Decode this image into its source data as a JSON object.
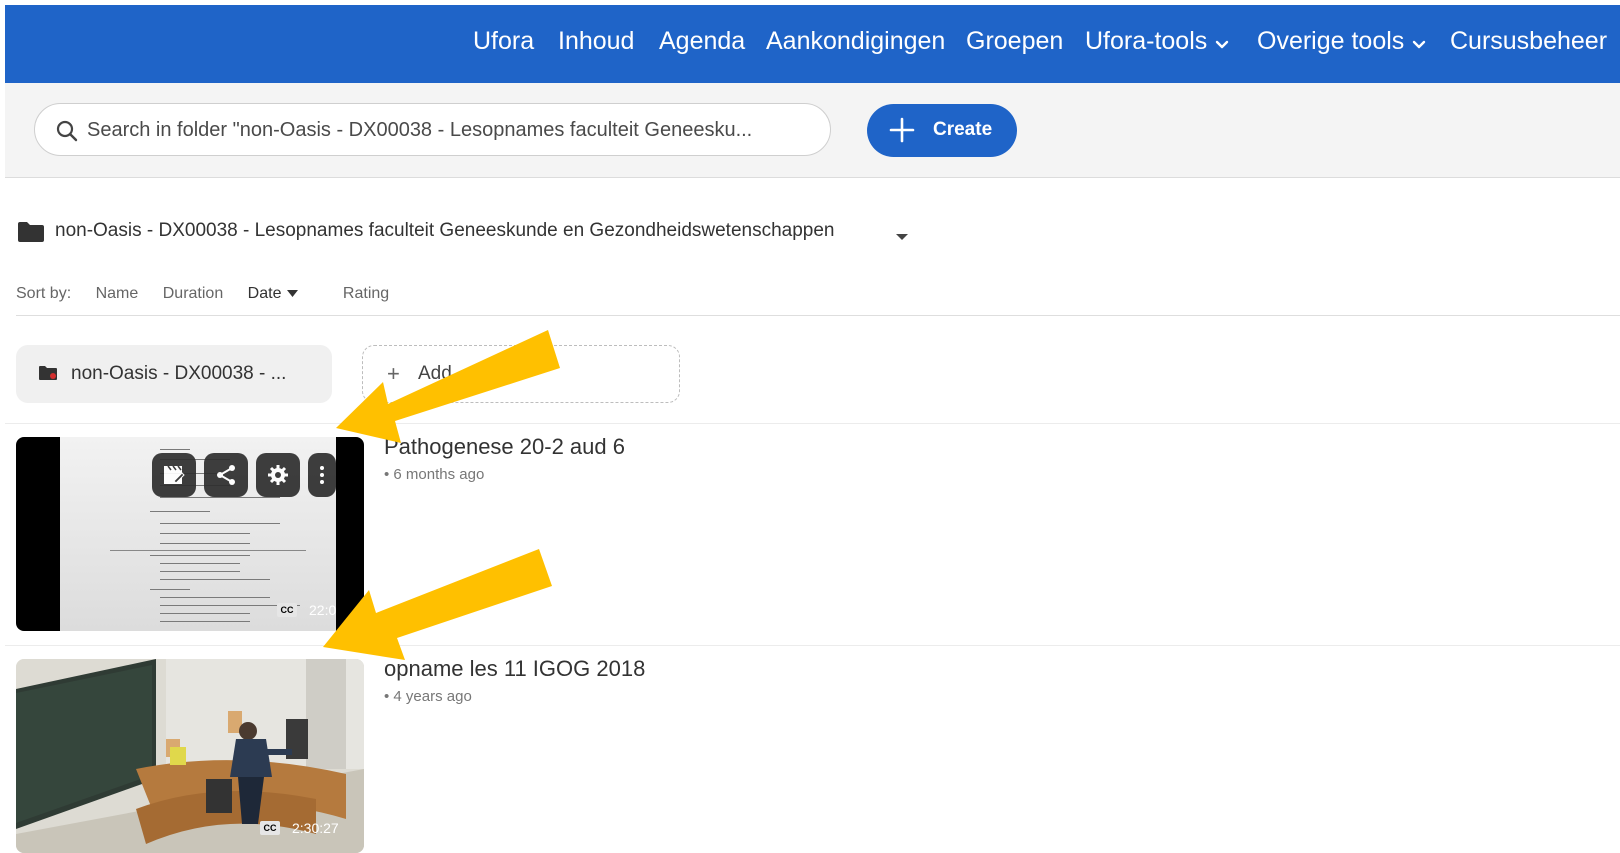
{
  "nav": {
    "items": [
      {
        "label": "Ufora"
      },
      {
        "label": "Inhoud"
      },
      {
        "label": "Agenda"
      },
      {
        "label": "Aankondigingen"
      },
      {
        "label": "Groepen"
      },
      {
        "label": "Ufora-tools",
        "icon": "chevron-down-icon"
      },
      {
        "label": "Overige tools",
        "icon": "chevron-down-icon"
      },
      {
        "label": "Cursusbeheer"
      }
    ]
  },
  "toolbar": {
    "search_placeholder": "Search in folder \"non-Oasis - DX00038 - Lesopnames faculteit Geneesku...",
    "create_label": "Create"
  },
  "folder": {
    "name": "non-Oasis - DX00038 - Lesopnames faculteit Geneeskunde en Gezondheidswetenschappen"
  },
  "sort": {
    "label": "Sort by:",
    "options": [
      "Name",
      "Duration",
      "Date",
      "Rating"
    ],
    "active": "Date"
  },
  "chips": {
    "folder_label": "non-Oasis - DX00038 - ...",
    "add_label": "Add"
  },
  "videos": [
    {
      "title": "Pathogenese 20-2 aud 6",
      "meta": "• 6 months ago",
      "duration": "22:0"
    },
    {
      "title": "opname les 11 IGOG 2018",
      "meta": "• 4 years ago",
      "duration": "2:30:27"
    }
  ],
  "cc_label": "CC",
  "colors": {
    "brand": "#1f64c8",
    "annotation_arrow": "#ffc000"
  }
}
